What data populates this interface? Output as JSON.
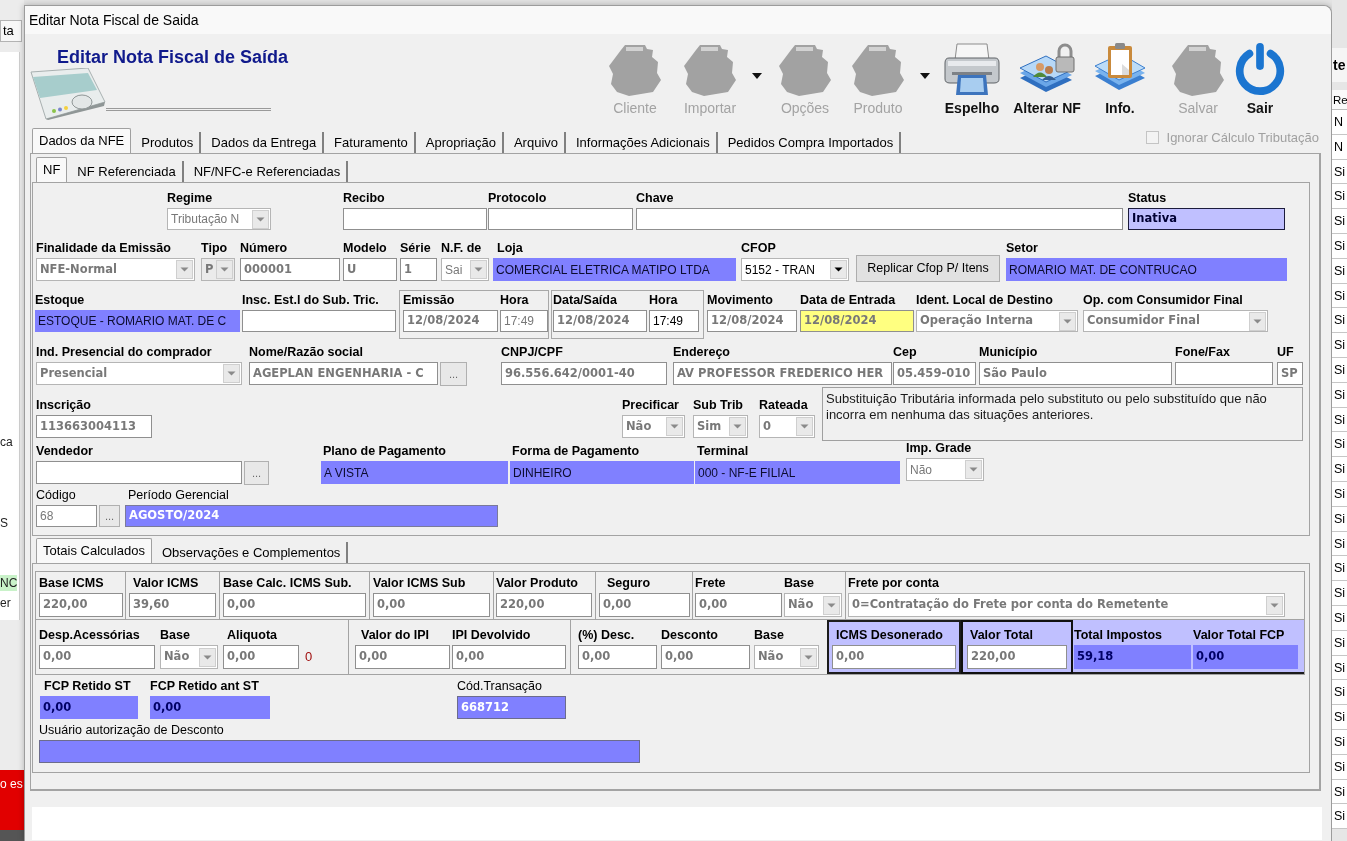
{
  "window": {
    "title": "Editar Nota Fiscal de Saida"
  },
  "header": {
    "title": "Editar Nota Fiscal de Saída"
  },
  "toolbar": [
    {
      "label": "Cliente",
      "kind": "silhouette",
      "disabled": true,
      "has_menu": false
    },
    {
      "label": "Importar",
      "kind": "silhouette",
      "disabled": true,
      "has_menu": true
    },
    {
      "label": "Opções",
      "kind": "silhouette",
      "disabled": true,
      "has_menu": false
    },
    {
      "label": "Produto",
      "kind": "silhouette",
      "disabled": true,
      "has_menu": true
    },
    {
      "label": "Espelho",
      "kind": "printer",
      "disabled": false,
      "has_menu": false
    },
    {
      "label": "Alterar NF",
      "kind": "locked_cards",
      "disabled": false,
      "has_menu": false
    },
    {
      "label": "Info.",
      "kind": "clipboard",
      "disabled": false,
      "has_menu": false
    },
    {
      "label": "Salvar",
      "kind": "silhouette",
      "disabled": true,
      "has_menu": false
    },
    {
      "label": "Sair",
      "kind": "power",
      "disabled": false,
      "has_menu": false
    }
  ],
  "tabs": [
    {
      "label": "Dados da NFE",
      "selected": true
    },
    {
      "label": "Produtos",
      "selected": false
    },
    {
      "label": "Dados da Entrega",
      "selected": false
    },
    {
      "label": "Faturamento",
      "selected": false
    },
    {
      "label": "Apropriação",
      "selected": false
    },
    {
      "label": "Arquivo",
      "selected": false
    },
    {
      "label": "Informações Adicionais",
      "selected": false
    },
    {
      "label": "Pedidos Compra Importados",
      "selected": false
    }
  ],
  "ignore_tax_calc": {
    "label": "Ignorar Cálculo Tributação",
    "checked": false,
    "disabled": true
  },
  "nf_tabs": [
    {
      "label": "NF",
      "selected": true
    },
    {
      "label": "NF Referenciada",
      "selected": false
    },
    {
      "label": "NF/NFC-e Referenciadas",
      "selected": false
    }
  ],
  "nf": {
    "regime": {
      "label": "Regime",
      "value": "Tributação N",
      "disabled": true
    },
    "recibo": {
      "label": "Recibo"
    },
    "protocolo": {
      "label": "Protocolo"
    },
    "chave": {
      "label": "Chave"
    },
    "status": {
      "label": "Status",
      "value": "Inativa",
      "disabled": false
    },
    "finalidade": {
      "label": "Finalidade da Emissão",
      "value": "NFE-Normal",
      "disabled": true
    },
    "tipo": {
      "label": "Tipo",
      "value": "P",
      "disabled": true
    },
    "numero": {
      "label": "Número",
      "value": "000001",
      "disabled": true
    },
    "modelo": {
      "label": "Modelo",
      "value": "U",
      "disabled": true
    },
    "serie": {
      "label": "Série",
      "value": "1",
      "disabled": true
    },
    "nf_de": {
      "label": "N.F. de",
      "value": "Sai",
      "disabled": true
    },
    "loja": {
      "label": "Loja",
      "value": "COMERCIAL ELETRICA MATIPO LTDA",
      "disabled": false
    },
    "cfop": {
      "label": "CFOP",
      "value": "5152 - TRAN",
      "disabled": false
    },
    "replicar_cfop_button": "Replicar Cfop P/ Itens",
    "setor": {
      "label": "Setor",
      "value": "ROMARIO MAT. DE CONTRUCAO",
      "disabled": false
    },
    "estoque": {
      "label": "Estoque",
      "value": "ESTOQUE - ROMARIO MAT. DE C",
      "disabled": false
    },
    "insc_sub_trib": {
      "label": "Insc. Est.l do Sub. Tric."
    },
    "emissao": {
      "label": "Emissão",
      "value": "12/08/2024",
      "disabled": true
    },
    "emissao_hora": {
      "label": "Hora",
      "value": "17:49",
      "disabled": true
    },
    "data_saida": {
      "label": "Data/Saída",
      "value": "12/08/2024",
      "disabled": true
    },
    "saida_hora": {
      "label": "Hora",
      "value": "17:49",
      "disabled": false
    },
    "movimento": {
      "label": "Movimento",
      "value": "12/08/2024",
      "disabled": true
    },
    "data_entrada": {
      "label": "Data de Entrada",
      "value": "12/08/2024",
      "disabled": true
    },
    "ident_local_destino": {
      "label": "Ident. Local de Destino",
      "value": "Operação Interna",
      "disabled": true
    },
    "op_consumidor_final": {
      "label": "Op. com Consumidor Final",
      "value": "Consumidor Final",
      "disabled": true
    },
    "ind_presencial": {
      "label": "Ind. Presencial do comprador",
      "value": "Presencial",
      "disabled": true
    },
    "nome": {
      "label": "Nome/Razão social",
      "value": "AGEPLAN ENGENHARIA - C",
      "disabled": true,
      "button": "..."
    },
    "cnpj_cpf": {
      "label": "CNPJ/CPF",
      "value": "96.556.642/0001-40",
      "disabled": true
    },
    "endereco": {
      "label": "Endereço",
      "value": "AV PROFESSOR FREDERICO HER",
      "disabled": true
    },
    "cep": {
      "label": "Cep",
      "value": "05.459-010",
      "disabled": true
    },
    "municipio": {
      "label": "Município",
      "value": "São Paulo",
      "disabled": true
    },
    "fone_fax": {
      "label": "Fone/Fax"
    },
    "uf": {
      "label": "UF",
      "value": "SP",
      "disabled": true
    },
    "inscricao": {
      "label": "Inscrição",
      "value": "113663004113",
      "disabled": true
    },
    "precificar": {
      "label": "Precificar",
      "value": "Não",
      "disabled": true
    },
    "sub_trib": {
      "label": "Sub Trib",
      "value": "Sim",
      "disabled": true
    },
    "rateada": {
      "label": "Rateada",
      "value": "0",
      "disabled": true
    },
    "st_note": "Substituição Tributária informada pelo substituto ou pelo substituído que não incorra em nenhuma das situações anteriores.",
    "vendedor": {
      "label": "Vendedor",
      "button": "..."
    },
    "plano_pagamento": {
      "label": "Plano de Pagamento",
      "value": "A VISTA",
      "disabled": false
    },
    "forma_pagamento": {
      "label": "Forma de Pagamento",
      "value": "DINHEIRO",
      "disabled": false
    },
    "terminal": {
      "label": "Terminal",
      "value": "000 - NF-E FILIAL",
      "disabled": false
    },
    "imp_grade": {
      "label": "Imp. Grade",
      "value": "Não",
      "disabled": true
    },
    "codigo": {
      "label": "Código",
      "value": "68",
      "disabled": true,
      "button": "..."
    },
    "periodo_gerencial": {
      "label": "Período Gerencial",
      "value": "AGOSTO/2024",
      "disabled": false
    }
  },
  "totals_tabs": [
    {
      "label": "Totais Calculados",
      "selected": true
    },
    {
      "label": "Observações e Complementos",
      "selected": false
    }
  ],
  "totals": {
    "base_icms": {
      "label": "Base ICMS",
      "value": "220,00",
      "disabled": true
    },
    "valor_icms": {
      "label": "Valor ICMS",
      "value": "39,60",
      "disabled": true
    },
    "base_calc_icms_sub": {
      "label": "Base Calc. ICMS Sub.",
      "value": "0,00",
      "disabled": true
    },
    "valor_icms_sub": {
      "label": "Valor ICMS Sub",
      "value": "0,00",
      "disabled": true
    },
    "valor_produto": {
      "label": "Valor Produto",
      "value": "220,00",
      "disabled": true
    },
    "seguro": {
      "label": "Seguro",
      "value": "0,00",
      "disabled": true
    },
    "frete": {
      "label": "Frete",
      "value": "0,00",
      "disabled": true
    },
    "frete_base": {
      "label": "Base",
      "value": "Não",
      "disabled": true
    },
    "frete_por_conta": {
      "label": "Frete por conta",
      "value": "0=Contratação do Frete por conta do Remetente",
      "disabled": true
    },
    "desp_acessorias": {
      "label": "Desp.Acessórias",
      "value": "0,00",
      "disabled": true
    },
    "desp_base": {
      "label": "Base",
      "value": "Não",
      "disabled": true
    },
    "aliquota": {
      "label": "Aliquota",
      "value": "0,00",
      "disabled": true,
      "counter": "0"
    },
    "valor_ipi": {
      "label": "Valor do IPI",
      "value": "0,00",
      "disabled": true
    },
    "ipi_devolvido": {
      "label": "IPI Devolvido",
      "value": "0,00",
      "disabled": true
    },
    "pct_desc": {
      "label": "(%) Desc.",
      "value": "0,00",
      "disabled": true
    },
    "desconto": {
      "label": "Desconto",
      "value": "0,00",
      "disabled": true
    },
    "desc_base": {
      "label": "Base",
      "value": "Não",
      "disabled": true
    },
    "icms_desonerado": {
      "label": "ICMS Desonerado",
      "value": "0,00",
      "disabled": true
    },
    "valor_total": {
      "label": "Valor Total",
      "value": "220,00",
      "disabled": true
    },
    "total_impostos": {
      "label": "Total Impostos",
      "value": "59,18",
      "disabled": false
    },
    "valor_total_fcp": {
      "label": "Valor Total FCP",
      "value": "0,00",
      "disabled": false
    },
    "fcp_retido_st": {
      "label": "FCP Retido ST",
      "value": "0,00",
      "disabled": false
    },
    "fcp_retido_ant_st": {
      "label": "FCP Retido ant ST",
      "value": "0,00",
      "disabled": false
    },
    "cod_transacao": {
      "label": "Cód.Transação",
      "value": "668712",
      "disabled": false
    },
    "usuario_autorizacao": {
      "label": "Usuário autorização de Desconto"
    }
  },
  "background": {
    "left_tab": "ta",
    "left_texts": [
      "ca",
      "S",
      "NC",
      "er"
    ],
    "alert_text": "o es",
    "right_title": "te",
    "right_header": "Re",
    "right_cells": [
      "N",
      "N",
      "Si",
      "Si",
      "Si",
      "Si",
      "Si",
      "Si",
      "Si",
      "Si",
      "Si",
      "Si",
      "Si",
      "Si",
      "Si",
      "Si",
      "Si",
      "Si",
      "Si",
      "Si",
      "Si",
      "Si",
      "Si",
      "Si",
      "Si",
      "Si",
      "Si",
      "Si",
      "Si"
    ]
  }
}
